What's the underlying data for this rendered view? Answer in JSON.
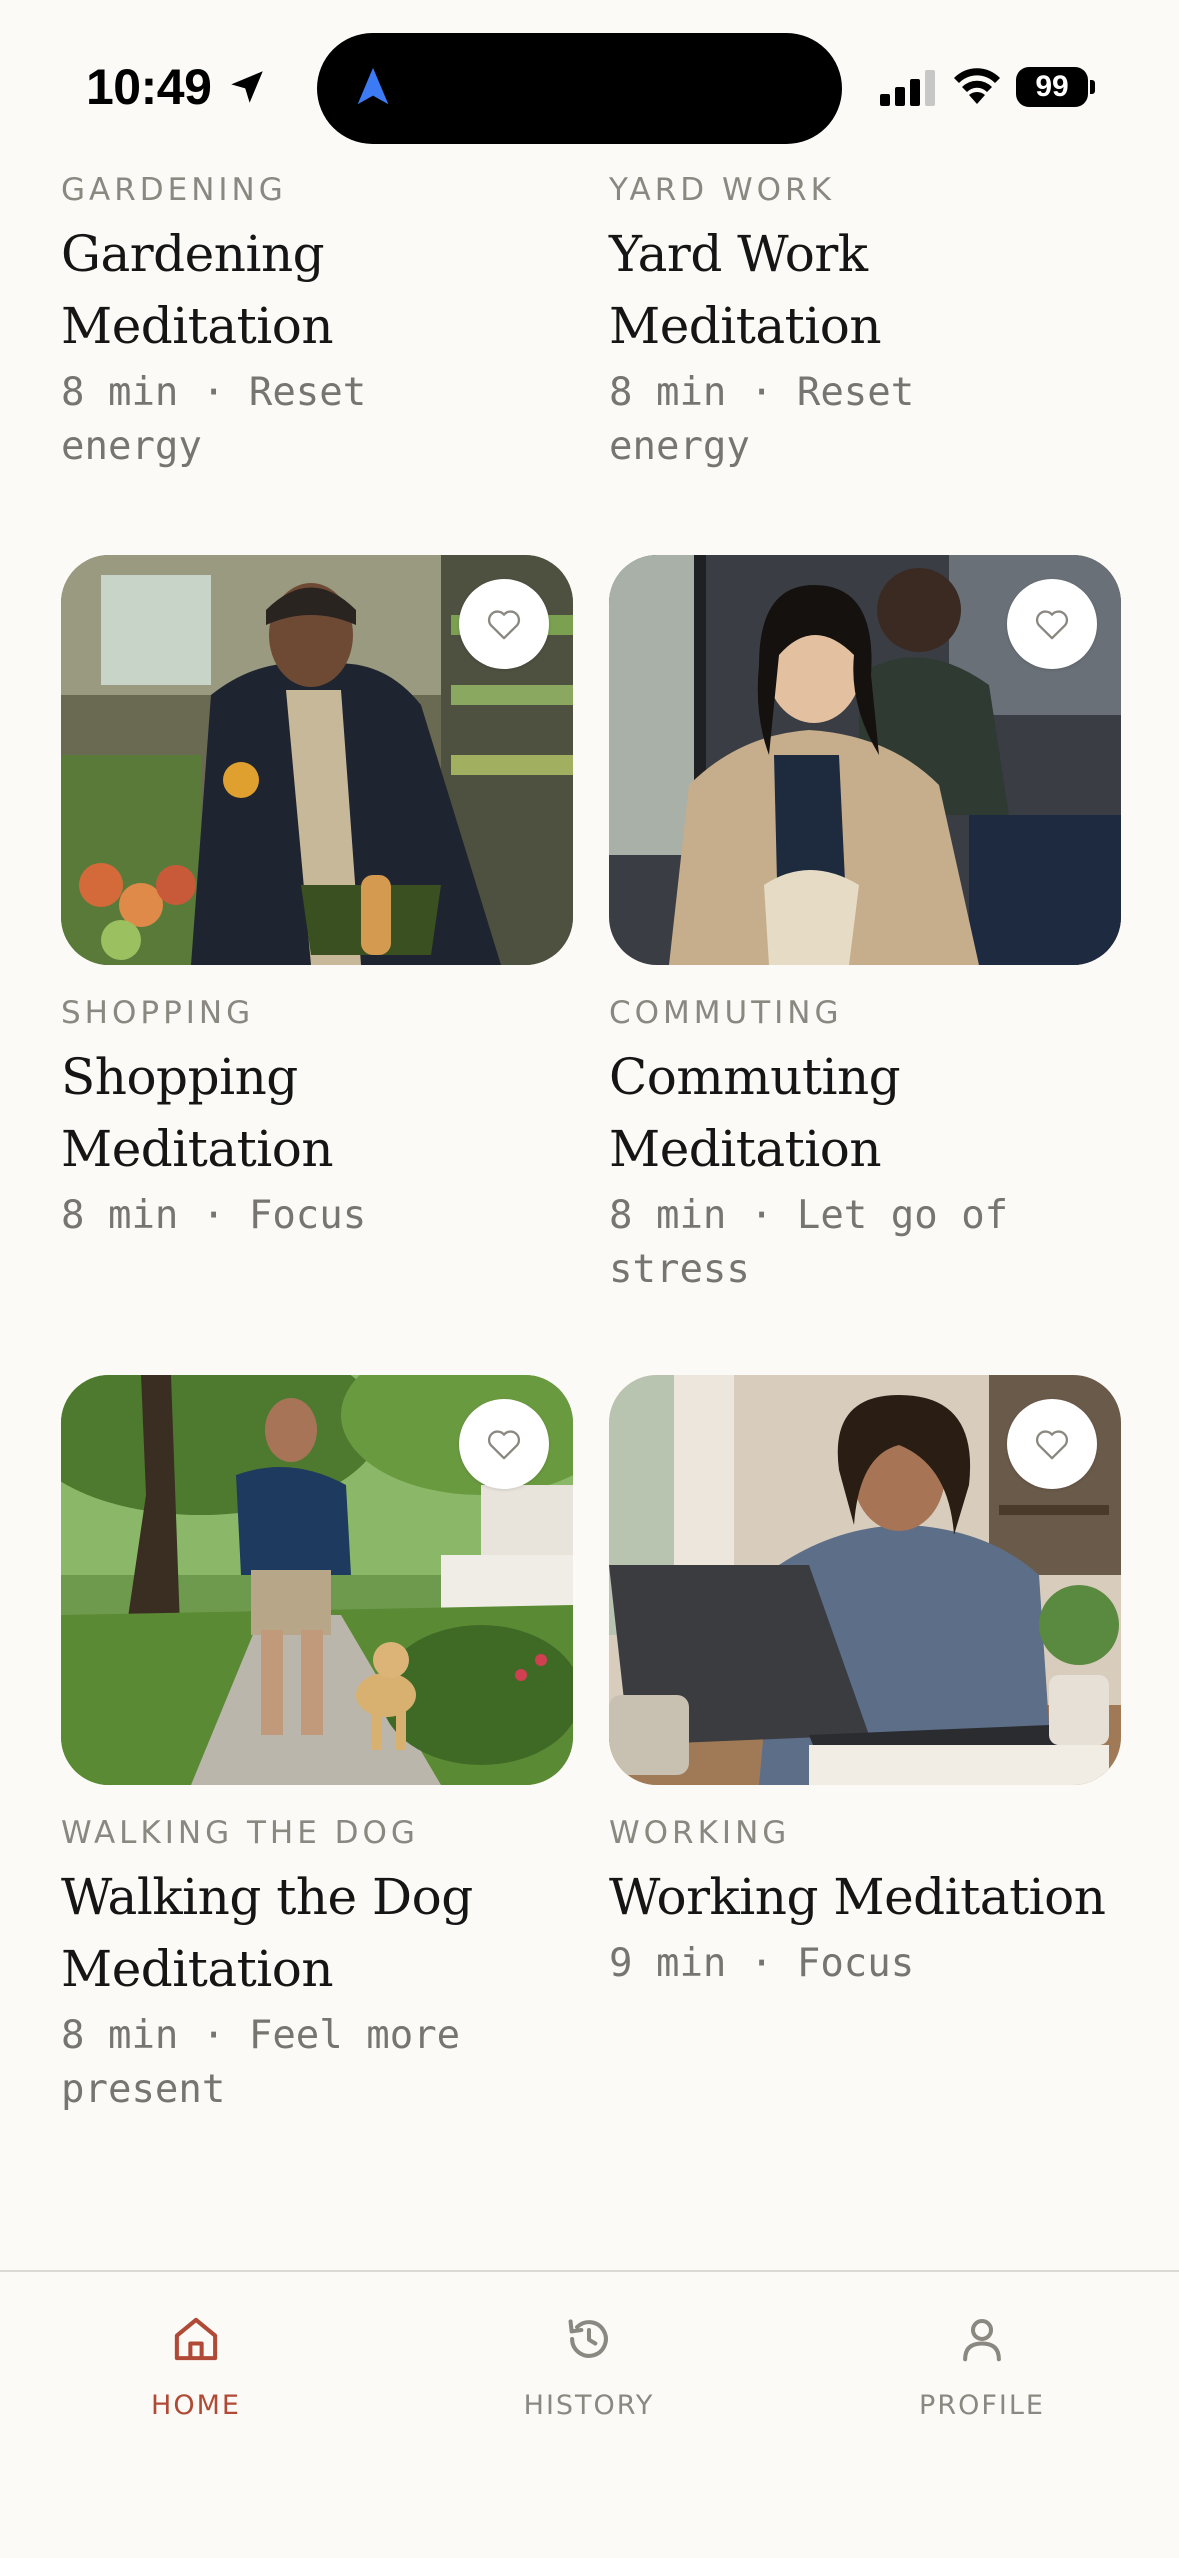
{
  "status_bar": {
    "time": "10:49",
    "battery": "99"
  },
  "cards": [
    {
      "category": "GARDENING",
      "title": "Gardening Meditation",
      "meta": "8 min · Reset energy",
      "has_image": false
    },
    {
      "category": "YARD WORK",
      "title": "Yard Work Meditation",
      "meta": "8 min · Reset energy",
      "has_image": false
    },
    {
      "category": "SHOPPING",
      "title": "Shopping Meditation",
      "meta": "8 min · Focus",
      "has_image": true,
      "image": "man-shopping-produce-photo"
    },
    {
      "category": "COMMUTING",
      "title": "Commuting Meditation",
      "meta": "8 min · Let go of stress",
      "has_image": true,
      "image": "woman-on-train-photo"
    },
    {
      "category": "WALKING THE DOG",
      "title": "Walking the Dog Meditation",
      "meta": "8 min · Feel more present",
      "has_image": true,
      "image": "man-walking-dog-photo"
    },
    {
      "category": "WORKING",
      "title": "Working Meditation",
      "meta": "9 min · Focus",
      "has_image": true,
      "image": "woman-working-laptop-photo"
    }
  ],
  "favorite_icon": "heart-outline-icon",
  "tab_bar": {
    "active": "home",
    "tabs": [
      {
        "id": "home",
        "label": "HOME",
        "icon": "home-icon"
      },
      {
        "id": "history",
        "label": "HISTORY",
        "icon": "history-icon"
      },
      {
        "id": "profile",
        "label": "PROFILE",
        "icon": "profile-icon"
      }
    ]
  },
  "colors": {
    "background": "#FBFAF6",
    "accent": "#B04A36",
    "muted": "#8a8880"
  }
}
